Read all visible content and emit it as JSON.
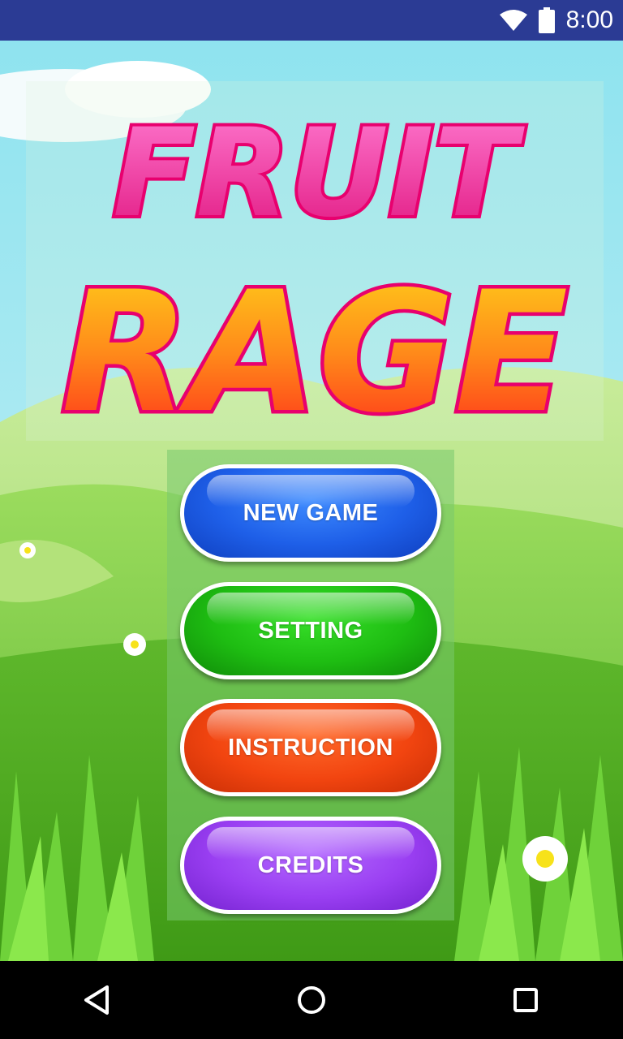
{
  "status_bar": {
    "time": "8:00",
    "wifi_icon": "wifi-icon",
    "battery_icon": "battery-icon"
  },
  "logo": {
    "line1": "FRUIT",
    "line2": "RAGE"
  },
  "menu": {
    "buttons": [
      {
        "label": "NEW GAME",
        "color": "#1e5fe8"
      },
      {
        "label": "SETTING",
        "color": "#1ebd12"
      },
      {
        "label": "INSTRUCTION",
        "color": "#f24510"
      },
      {
        "label": "CREDITS",
        "color": "#9a3ff2"
      }
    ]
  },
  "nav_bar": {
    "back_icon": "back-triangle-icon",
    "home_icon": "home-circle-icon",
    "recents_icon": "recents-square-icon"
  }
}
